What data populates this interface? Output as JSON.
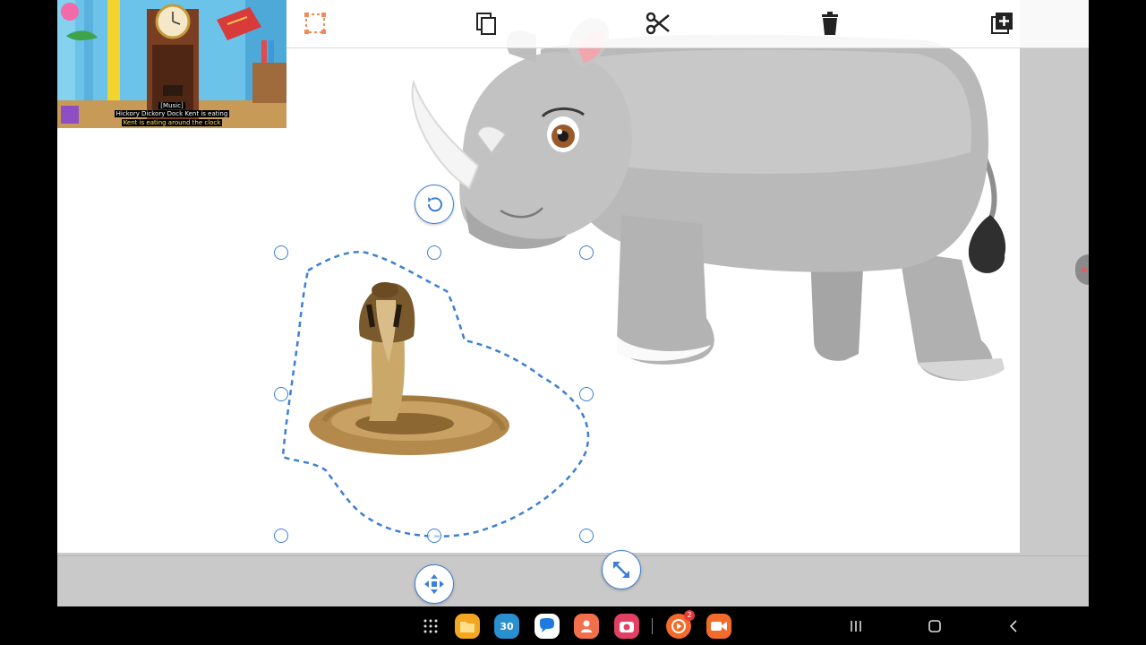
{
  "video": {
    "caption_line1": "[Music]",
    "caption_line2": "Hickory Dickory Dock Kent is eating",
    "caption_line3": "Kent is eating around the clock"
  },
  "toolbar": {
    "icons": [
      "lasso-select-icon",
      "copy-icon",
      "cut-icon",
      "delete-icon",
      "add-page-icon"
    ]
  },
  "colors": {
    "selection": "#3c7fd6",
    "lasso_icon": "#f08a5d",
    "app_background": "#c9c9c9"
  },
  "dock": {
    "calendar_day": "30",
    "badge_count": "2",
    "apps": [
      "app-drawer",
      "my-files",
      "calendar",
      "messages",
      "contacts",
      "screen-recorder",
      "youtube-music",
      "video-recorder"
    ]
  },
  "nav": {
    "buttons": [
      "recents",
      "home",
      "back"
    ]
  }
}
